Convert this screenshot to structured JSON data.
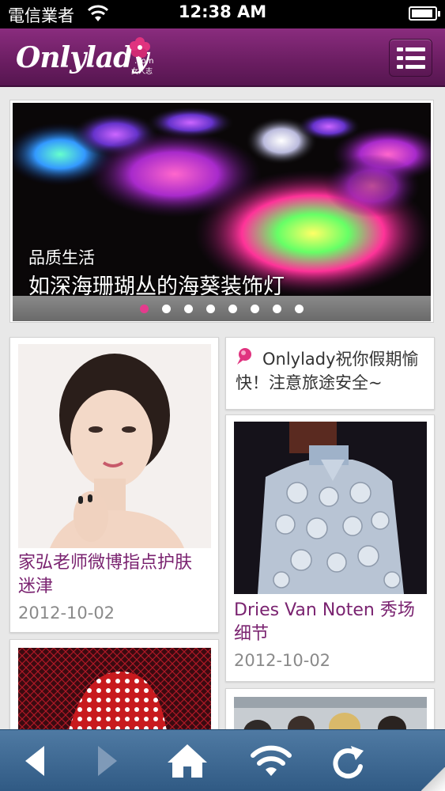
{
  "status_bar": {
    "carrier": "電信業者",
    "time": "12:38 AM",
    "icons": [
      "wifi-icon",
      "battery-icon"
    ]
  },
  "header": {
    "logo_text": "Onlylady",
    "logo_dotcom": ".com",
    "logo_sub": "女人志",
    "menu_icon": "menu-list-icon"
  },
  "banner": {
    "category": "品质生活",
    "title": "如深海珊瑚丛的海葵装饰灯",
    "slide_count": 8,
    "active_slide": 1
  },
  "notice": {
    "icon": "speech-bubble-icon",
    "text": "Onlylady祝你假期愉快！注意旅途安全~"
  },
  "articles": [
    {
      "title": "家弘老师微博指点护肤迷津",
      "date": "2012-10-02"
    },
    {
      "title": "Dries Van Noten 秀场细节",
      "date": "2012-10-02"
    }
  ],
  "toolbar": {
    "buttons": [
      "back-icon",
      "forward-icon",
      "home-icon",
      "wifi-icon",
      "refresh-icon"
    ]
  },
  "colors": {
    "header_purple": "#6a1d61",
    "title_purple": "#7a2370",
    "active_dot": "#e43b8d",
    "toolbar_blue": "#3d678f"
  }
}
